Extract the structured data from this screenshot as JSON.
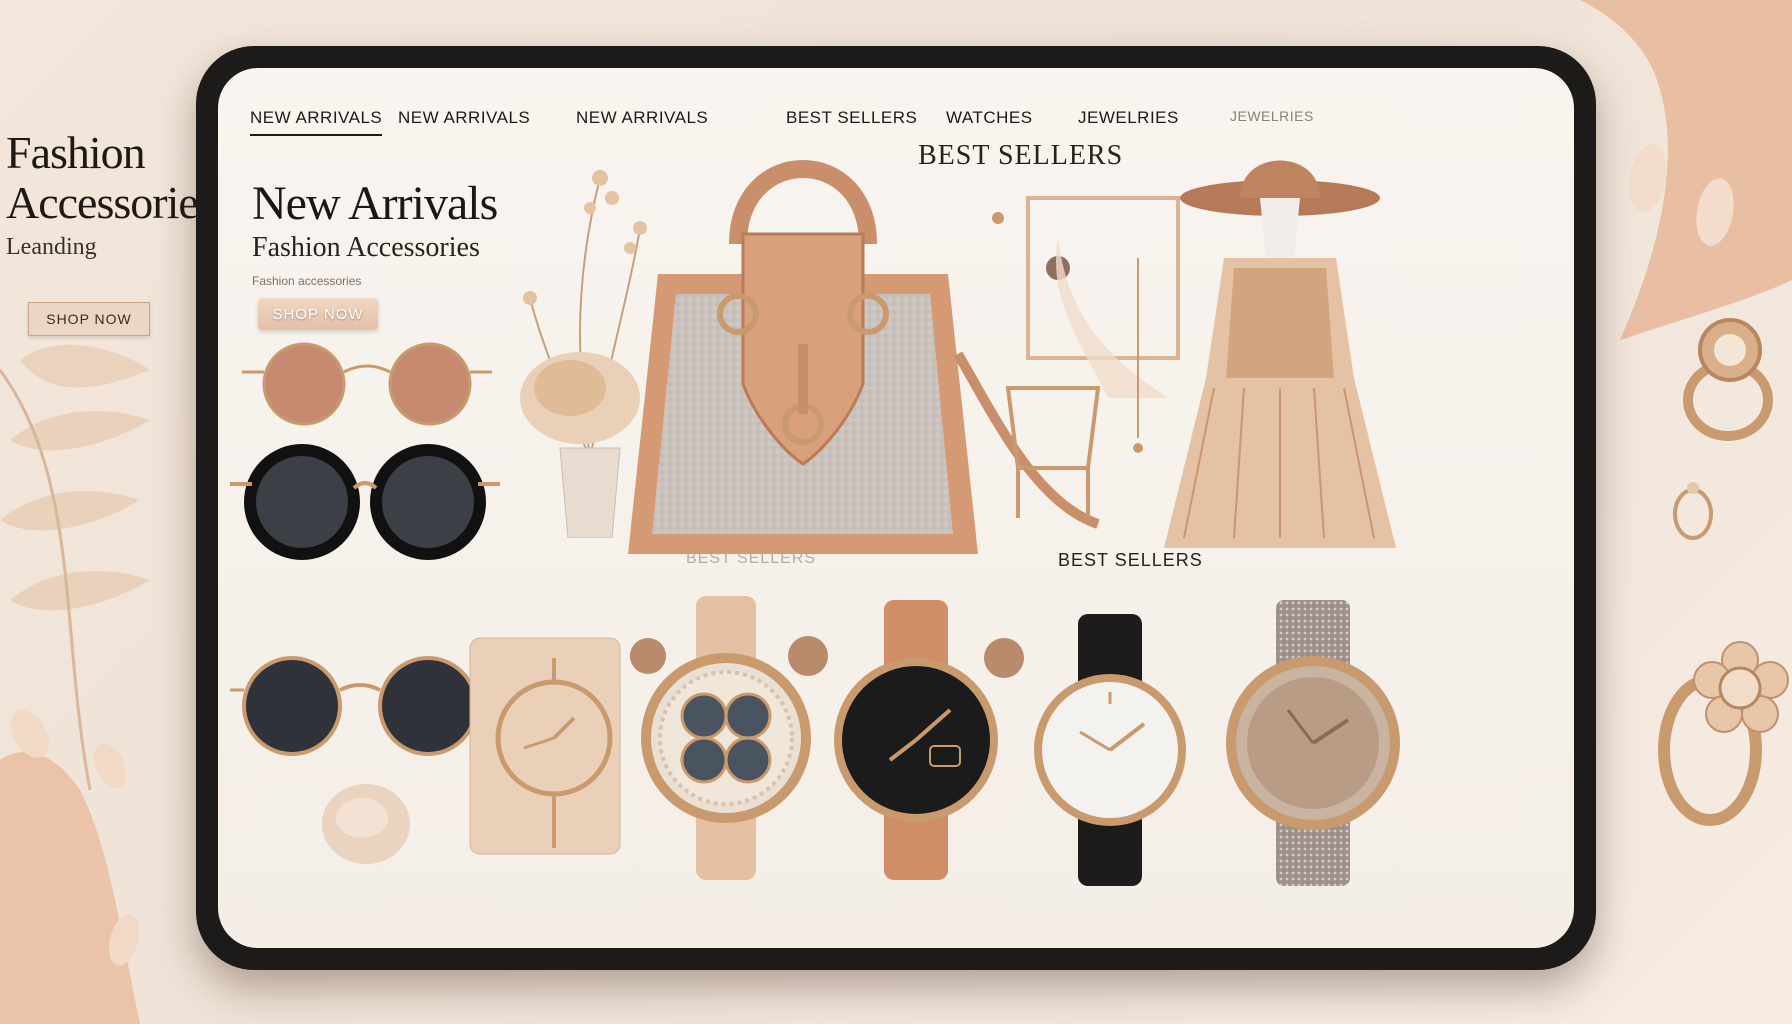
{
  "side": {
    "title": "Fashion Accessories",
    "tagline": "Leanding",
    "cta": "SHOP NOW"
  },
  "nav": {
    "items": [
      {
        "label": "NEW ARRIVALS",
        "state": "active"
      },
      {
        "label": "NEW ARRIVALS",
        "state": "normal"
      },
      {
        "label": "NEW ARRIVALS",
        "state": "normal"
      },
      {
        "label": "BEST SELLERS",
        "state": "normal"
      },
      {
        "label": "WATCHES",
        "state": "normal"
      },
      {
        "label": "JEWELRIES",
        "state": "normal"
      },
      {
        "label": "JEWELRIES",
        "state": "muted"
      }
    ]
  },
  "hero": {
    "title": "New Arrivals",
    "subtitle": "Fashion Accessories",
    "note": "Fashion accessories",
    "cta": "SHOP NOW"
  },
  "labels": {
    "best_sellers_top": "BEST SELLERS",
    "best_sellers_faded": "BEST SELLERS",
    "best_sellers_main": "BEST SELLERS"
  },
  "products": {
    "sunglasses": [
      "rose-tint-round-sunglasses",
      "black-round-sunglasses",
      "gold-wire-round-sunglasses"
    ],
    "bag": "tan-leather-handbag",
    "mannequin": "blush-pleated-dress-with-hat",
    "watches": [
      "beige-case-watch",
      "rose-gold-jeweled-watch",
      "black-dial-watch",
      "white-dial-watch",
      "gold-mesh-watch"
    ]
  },
  "colors": {
    "accent": "#c98e6a",
    "tan": "#d59a74",
    "rose_gold": "#c99a6e",
    "bezel": "#1d1b1a",
    "screen": "#f6f1eb"
  }
}
